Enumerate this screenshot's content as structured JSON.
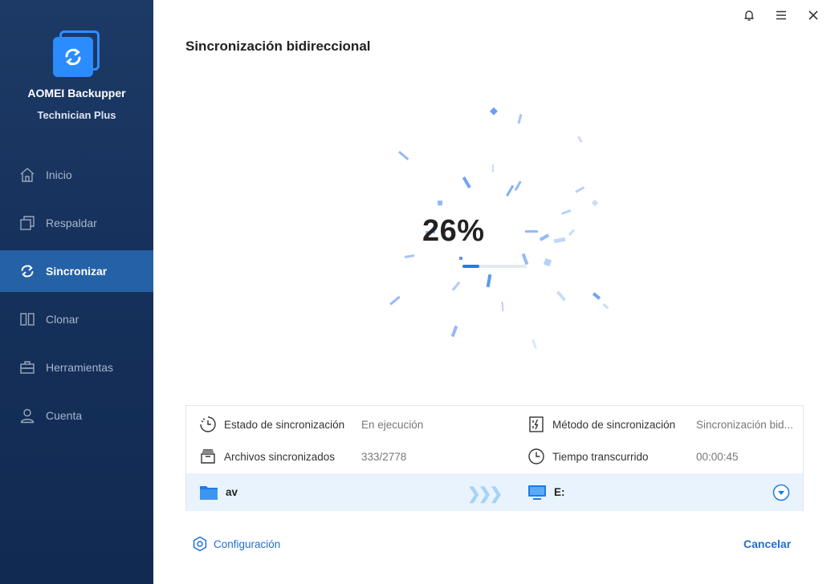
{
  "app": {
    "name": "AOMEI Backupper",
    "edition": "Technician Plus"
  },
  "sidebar": {
    "items": [
      {
        "label": "Inicio",
        "icon": "home-icon",
        "active": false
      },
      {
        "label": "Respaldar",
        "icon": "backup-icon",
        "active": false
      },
      {
        "label": "Sincronizar",
        "icon": "sync-icon",
        "active": true
      },
      {
        "label": "Clonar",
        "icon": "clone-icon",
        "active": false
      },
      {
        "label": "Herramientas",
        "icon": "toolbox-icon",
        "active": false
      },
      {
        "label": "Cuenta",
        "icon": "user-icon",
        "active": false
      }
    ]
  },
  "window": {
    "icons": [
      "bell-icon",
      "menu-icon",
      "close-icon"
    ]
  },
  "page": {
    "title": "Sincronización bidireccional"
  },
  "progress": {
    "percent_label": "26%",
    "fraction": 0.26
  },
  "details": {
    "status_label": "Estado de sincronización",
    "status_value": "En ejecución",
    "method_label": "Método de sincronización",
    "method_value": "Sincronización bid...",
    "files_label": "Archivos sincronizados",
    "files_value": "333/2778",
    "elapsed_label": "Tiempo transcurrido",
    "elapsed_value": "00:00:45"
  },
  "paths": {
    "source": "av",
    "arrows": "❯❯❯",
    "destination": "E:"
  },
  "footer": {
    "config_label": "Configuración",
    "cancel_label": "Cancelar"
  },
  "colors": {
    "accent": "#1e6fd2",
    "sidebar_bg": "#15305a",
    "active_item": "#2461a6"
  }
}
